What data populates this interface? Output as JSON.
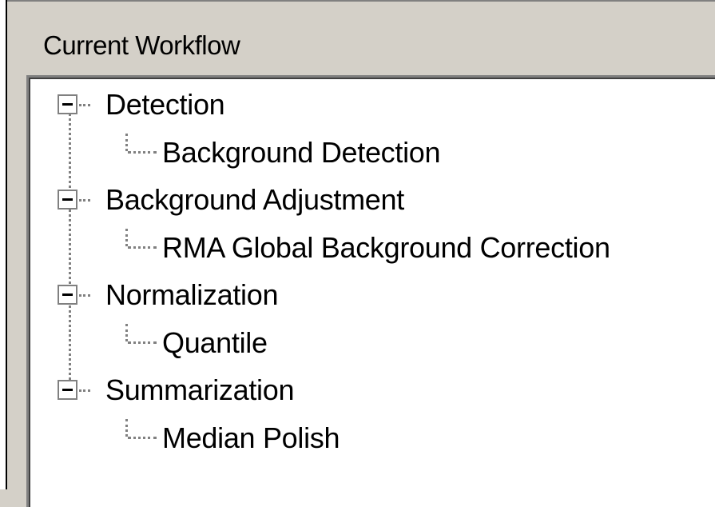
{
  "group": {
    "label": "Current Workflow"
  },
  "tree": {
    "nodes": [
      {
        "label": "Detection",
        "expander": "minus-icon",
        "children": [
          "Background Detection"
        ]
      },
      {
        "label": "Background Adjustment",
        "expander": "minus-icon",
        "children": [
          "RMA Global Background Correction"
        ]
      },
      {
        "label": "Normalization",
        "expander": "minus-icon",
        "children": [
          "Quantile"
        ]
      },
      {
        "label": "Summarization",
        "expander": "minus-icon",
        "children": [
          "Median Polish"
        ]
      }
    ]
  }
}
